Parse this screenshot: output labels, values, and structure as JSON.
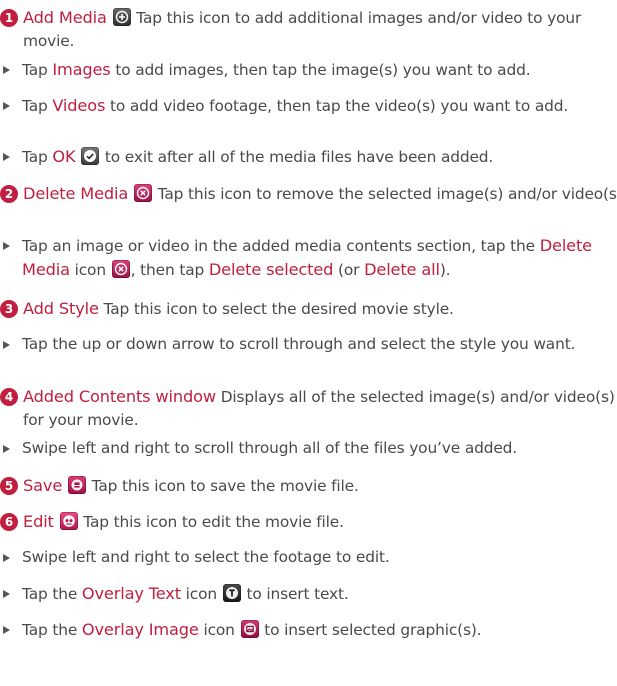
{
  "sections": [
    {
      "number": "1",
      "title": "Add Media",
      "icon": "add-media-icon",
      "description": "Tap this icon to add additional images and/or video to your movie.",
      "bullets": [
        {
          "pre": "Tap ",
          "term": "Images",
          "post": " to add images, then tap the image(s) you want to add."
        },
        {
          "pre": "Tap ",
          "term": "Videos",
          "post": " to add video footage, then tap the video(s) you want to add."
        },
        {
          "pre": "Tap ",
          "term": "OK",
          "icon": "ok-icon",
          "post": " to exit after all of the media files have been added."
        }
      ]
    },
    {
      "number": "2",
      "title": "Delete Media",
      "icon": "delete-media-icon",
      "description": "Tap this icon to remove the selected image(s) and/or video(s).",
      "bullet": {
        "pre": "Tap an image or video in the added media contents section, tap the ",
        "term1": "Delete Media",
        "mid": " icon",
        "icon": "delete-media-icon",
        "mid2": ", then tap ",
        "term2": "Delete selected",
        "mid3": " (or ",
        "term3": "Delete all",
        "post": ")."
      }
    },
    {
      "number": "3",
      "title": "Add Style",
      "description": "Tap this icon to select the desired movie style.",
      "bullets": [
        {
          "text": "Tap the up or down arrow to scroll through and select the style you want."
        }
      ]
    },
    {
      "number": "4",
      "title": "Added Contents window",
      "description": "Displays all of the selected image(s) and/or video(s) for your movie.",
      "bullets": [
        {
          "text": "Swipe left and right to scroll through all of the files you’ve added."
        }
      ]
    },
    {
      "number": "5",
      "title": "Save",
      "icon": "save-icon",
      "description": "Tap this icon to save the movie file."
    },
    {
      "number": "6",
      "title": "Edit",
      "icon": "edit-icon",
      "description": "Tap this icon to edit the movie file.",
      "bullets": [
        {
          "text": "Swipe left and right to select the footage to edit."
        },
        {
          "pre": "Tap the ",
          "term": "Overlay Text",
          "post": " icon",
          "icon": "overlay-text-icon",
          "post2": " to insert text."
        },
        {
          "pre": "Tap the ",
          "term": "Overlay Image",
          "post": " icon",
          "icon": "overlay-image-icon",
          "post2": " to insert selected graphic(s)."
        }
      ]
    }
  ],
  "colors": {
    "accent": "#c01f3f",
    "body_text": "#4a4a4a",
    "bullet": "#555555"
  }
}
